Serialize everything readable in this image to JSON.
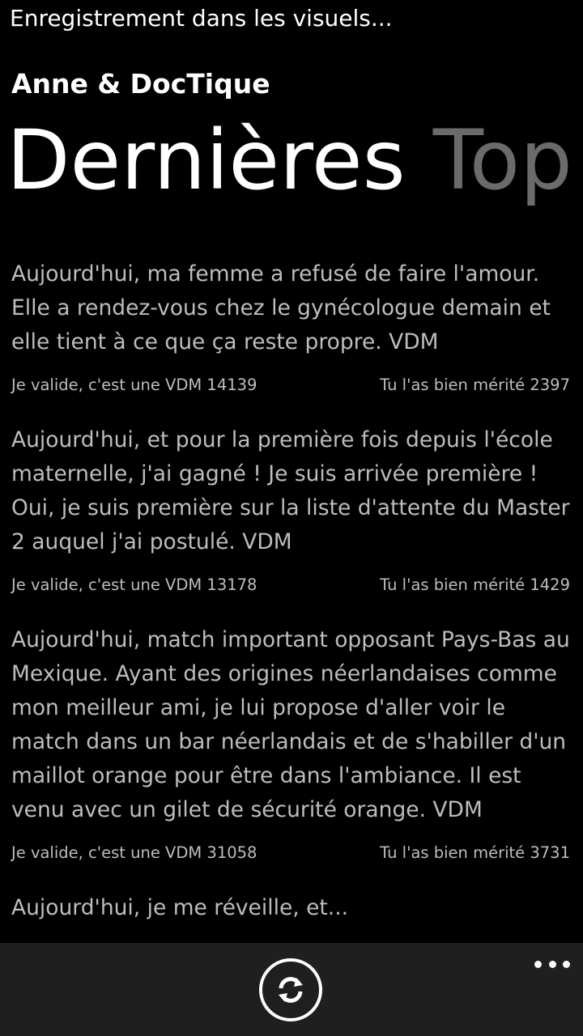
{
  "status_bar": {
    "text": "Enregistrement dans les visuels..."
  },
  "app": {
    "title": "Anne & DocTique"
  },
  "pivot": {
    "items": [
      {
        "label": "Dernières",
        "active": true
      },
      {
        "label": "Top",
        "active": false
      }
    ]
  },
  "posts": [
    {
      "text": "Aujourd'hui, ma femme a refusé de faire l'amour. Elle a rendez-vous chez le gynécologue demain et elle tient à ce que ça reste propre. VDM",
      "validate": "Je valide, c'est une VDM 14139",
      "deserved": "Tu l'as bien mérité 2397"
    },
    {
      "text": "Aujourd'hui, et pour la première fois depuis l'école maternelle, j'ai gagné ! Je suis arrivée première ! Oui, je suis première sur la liste d'attente du Master 2 auquel j'ai postulé. VDM",
      "validate": "Je valide, c'est une VDM 13178",
      "deserved": "Tu l'as bien mérité 1429"
    },
    {
      "text": "Aujourd'hui, match important opposant Pays-Bas au Mexique. Ayant des origines néerlandaises comme mon meilleur ami, je lui propose d'aller voir le match dans un bar néerlandais et de s'habiller d'un maillot orange pour être dans l'ambiance. Il est venu avec un gilet de sécurité orange. VDM",
      "validate": "Je valide, c'est une VDM 31058",
      "deserved": "Tu l'as bien mérité 3731"
    },
    {
      "text": "Aujourd'hui, je me réveille, et...",
      "validate": "",
      "deserved": ""
    }
  ],
  "app_bar": {
    "refresh_icon": "refresh-icon",
    "more_icon": "more-icon"
  },
  "colors": {
    "background": "#000000",
    "app_bar": "#1f1f1f",
    "text_primary": "#ffffff",
    "text_secondary": "#bdbdbd",
    "pivot_inactive": "#6b6b6b"
  }
}
